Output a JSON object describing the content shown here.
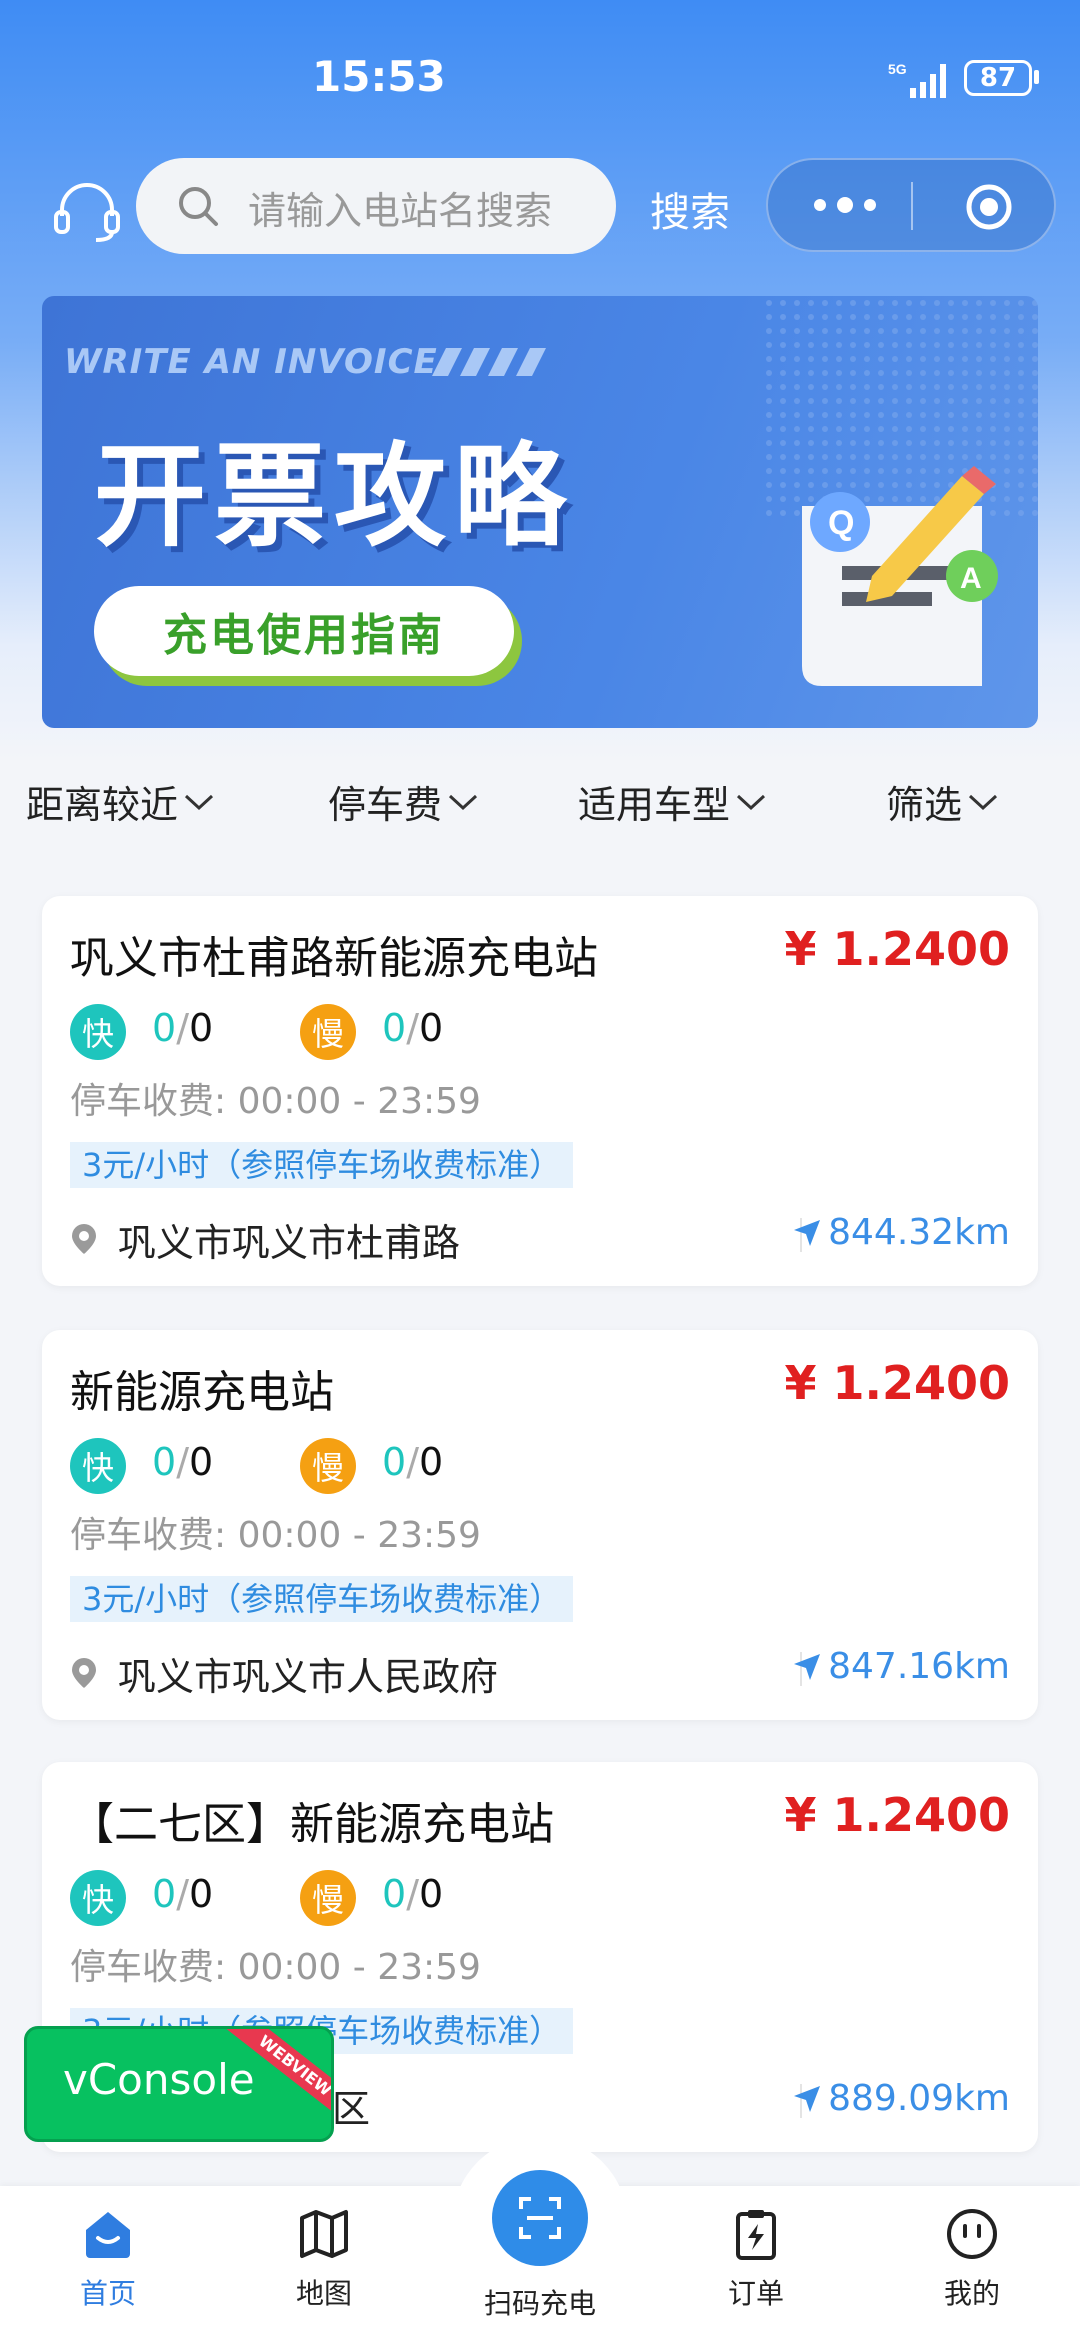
{
  "status_bar": {
    "time": "15:53",
    "network": "5G",
    "battery": "87"
  },
  "header": {
    "search_placeholder": "请输入电站名搜索",
    "search_button": "搜索"
  },
  "banner": {
    "english": "WRITE AN INVOICE",
    "title": "开票攻略",
    "subtitle": "充电使用指南"
  },
  "filters": [
    {
      "label": "距离较近"
    },
    {
      "label": "停车费"
    },
    {
      "label": "适用车型"
    },
    {
      "label": "筛选"
    }
  ],
  "stations": [
    {
      "name": "巩义市杜甫路新能源充电站",
      "price": "¥ 1.2400",
      "fast_label": "快",
      "fast_available": "0",
      "fast_total": "0",
      "slow_label": "慢",
      "slow_available": "0",
      "slow_total": "0",
      "parking": "停车收费:  00:00 - 23:59",
      "fee_tag": "3元/小时（参照停车场收费标准）",
      "address": "巩义市巩义市杜甫路",
      "distance": "844.32km"
    },
    {
      "name": "新能源充电站",
      "price": "¥ 1.2400",
      "fast_label": "快",
      "fast_available": "0",
      "fast_total": "0",
      "slow_label": "慢",
      "slow_available": "0",
      "slow_total": "0",
      "parking": "停车收费:  00:00 - 23:59",
      "fee_tag": "3元/小时（参照停车场收费标准）",
      "address": "巩义市巩义市人民政府",
      "distance": "847.16km"
    },
    {
      "name": "【二七区】新能源充电站",
      "price": "¥ 1.2400",
      "fast_label": "快",
      "fast_available": "0",
      "fast_total": "0",
      "slow_label": "慢",
      "slow_available": "0",
      "slow_total": "0",
      "parking": "停车收费:  00:00 - 23:59",
      "fee_tag": "3元/小时（参照停车场收费标准）",
      "address": "区",
      "distance": "889.09km"
    }
  ],
  "vconsole": {
    "label": "vConsole",
    "ribbon": "WEBVIEW"
  },
  "tabbar": {
    "home": "首页",
    "map": "地图",
    "scan": "扫码充电",
    "orders": "订单",
    "mine": "我的"
  },
  "colors": {
    "accent": "#2f7de0",
    "price": "#e02020",
    "fast": "#1ec5bd",
    "slow": "#f5a012"
  }
}
